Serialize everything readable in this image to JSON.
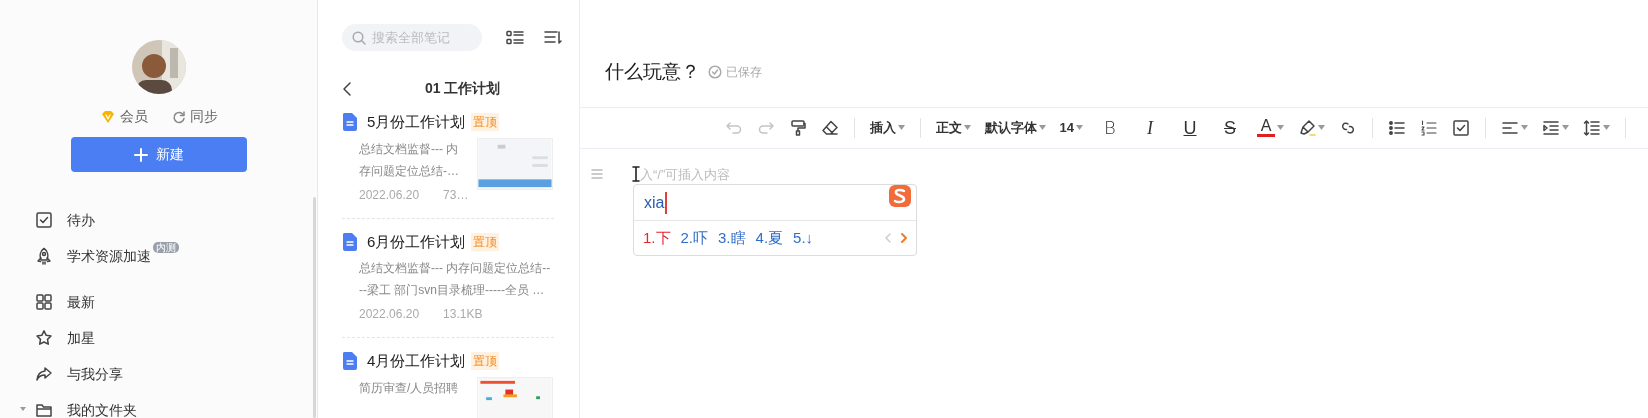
{
  "sidebar": {
    "avatar": {
      "kind": "picture"
    },
    "member_label": "会员",
    "sync_label": "同步",
    "new_button": "新建",
    "groups": [
      [
        {
          "label": "待办"
        },
        {
          "label": "学术资源加速",
          "badge": "内测"
        }
      ],
      [
        {
          "label": "最新"
        },
        {
          "label": "加星"
        },
        {
          "label": "与我分享"
        },
        {
          "label": "我的文件夹",
          "expanded": true
        }
      ]
    ]
  },
  "note_list": {
    "search": {
      "placeholder": "搜索全部笔记"
    },
    "folder_title": "01 工作计划",
    "notes": [
      {
        "title": "5月份工作计划",
        "tag": "置顶",
        "snippet": "总结文档监督--- 内存问题定位总结-…",
        "date": "2022.06.20",
        "size": "73…",
        "thumbnail": {
          "kind": "picture"
        }
      },
      {
        "title": "6月份工作计划",
        "tag": "置顶",
        "snippet": "总结文档监督--- 内存问题定位总结----梁工 部门svn目录梳理-----全员 …",
        "date": "2022.06.20",
        "size": "13.1KB"
      },
      {
        "title": "4月份工作计划",
        "tag": "置顶",
        "snippet": "简历审查/人员招聘",
        "thumbnail": {
          "kind": "picture"
        }
      }
    ]
  },
  "editor": {
    "title": "什么玩意？",
    "save_status": "已保存",
    "toolbar": [
      {
        "kind": "icon",
        "disabled": true
      },
      {
        "kind": "icon",
        "disabled": true
      },
      {
        "kind": "icon",
        "disabled": false
      },
      {
        "kind": "icon",
        "disabled": false
      },
      {
        "kind": "divider"
      },
      {
        "kind": "dropdown",
        "label": "插入"
      },
      {
        "kind": "divider"
      },
      {
        "kind": "dropdown",
        "label": "正文"
      },
      {
        "kind": "dropdown",
        "label": "默认字体"
      },
      {
        "kind": "dropdown",
        "label": "14"
      },
      {
        "kind": "letter",
        "label": "B"
      },
      {
        "kind": "letter",
        "label": "I"
      },
      {
        "kind": "letter",
        "label": "U"
      },
      {
        "kind": "letter",
        "label": "S"
      },
      {
        "kind": "color",
        "label": "A",
        "color": "#e02020"
      },
      {
        "kind": "icon",
        "disabled": false,
        "caret": true
      },
      {
        "kind": "icon",
        "disabled": false
      },
      {
        "kind": "divider"
      },
      {
        "kind": "icon",
        "disabled": false
      },
      {
        "kind": "icon",
        "disabled": false
      },
      {
        "kind": "icon",
        "disabled": false
      },
      {
        "kind": "divider"
      },
      {
        "kind": "icon",
        "disabled": false,
        "caret": true
      },
      {
        "kind": "icon",
        "disabled": false,
        "caret": true
      },
      {
        "kind": "icon",
        "disabled": false,
        "caret": true
      },
      {
        "kind": "divider"
      }
    ],
    "placeholder": "入“/”可插入内容",
    "ime": {
      "input": "xia",
      "candidates": [
        {
          "label": "1.下",
          "selected": true
        },
        {
          "label": "2.吓",
          "selected": false
        },
        {
          "label": "3.瞎",
          "selected": false
        },
        {
          "label": "4.夏",
          "selected": false
        },
        {
          "label": "5.↓",
          "selected": false
        }
      ],
      "prev_disabled": true,
      "next_disabled": false
    }
  }
}
